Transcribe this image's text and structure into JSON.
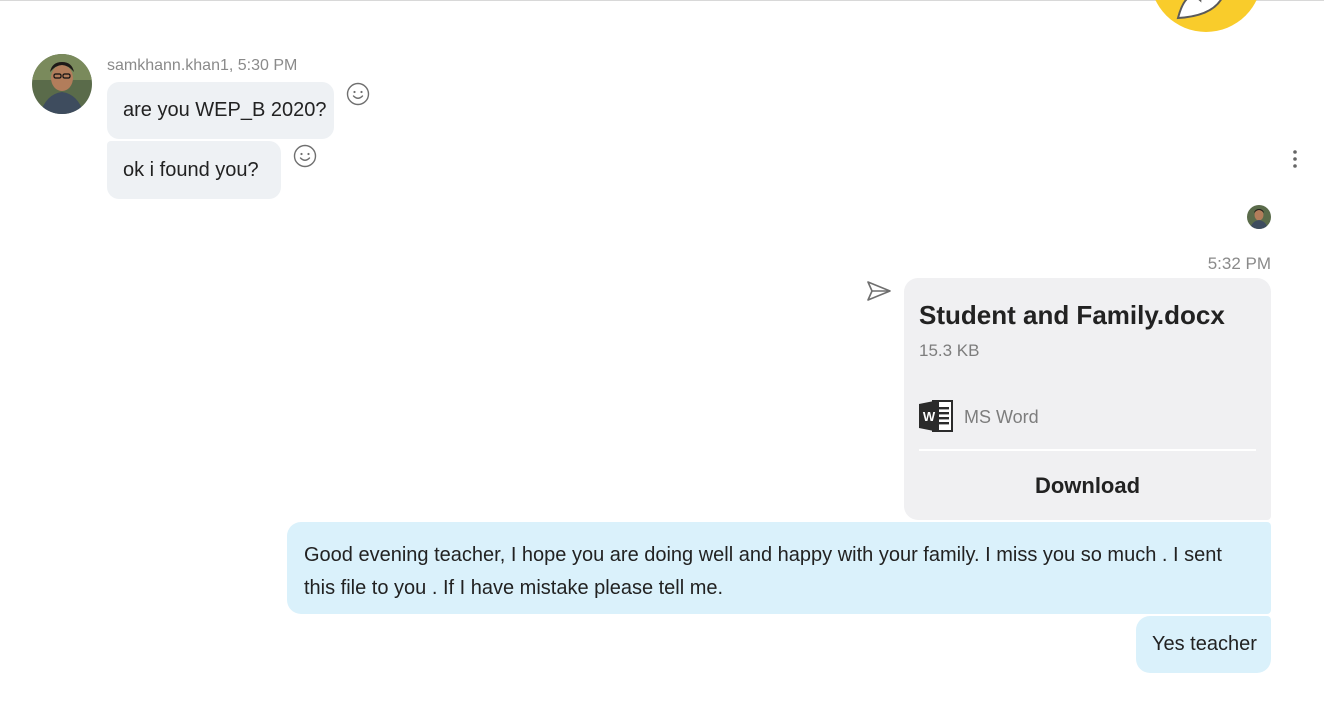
{
  "conversation": {
    "contact": {
      "sender_line": "samkhann.khan1, 5:30 PM"
    },
    "incoming": [
      {
        "text": "are you WEP_B 2020?"
      },
      {
        "text": "ok i found you?"
      }
    ],
    "outgoing_time": "5:32 PM",
    "file": {
      "name": "Student and Family.docx",
      "size": "15.3 KB",
      "type": "MS Word",
      "download_label": "Download"
    },
    "outgoing": [
      {
        "text": "Good evening teacher, I hope you are doing well and happy with your family. I miss you so much . I sent this file to you . If I have mistake  please tell me."
      },
      {
        "text": "Yes teacher"
      }
    ]
  },
  "icons": {
    "reaction": "smiley-face-icon",
    "more": "vertical-ellipsis-icon",
    "sent_status": "paper-plane-icon",
    "file_type": "ms-word-icon",
    "emoji": "emoji-sticker-icon"
  },
  "colors": {
    "incoming_bubble": "#eef1f4",
    "outgoing_bubble": "#daf1fb",
    "file_card": "#f0f0f2",
    "meta_text": "#8a8a8a",
    "word_icon": "#2b2b2b"
  }
}
